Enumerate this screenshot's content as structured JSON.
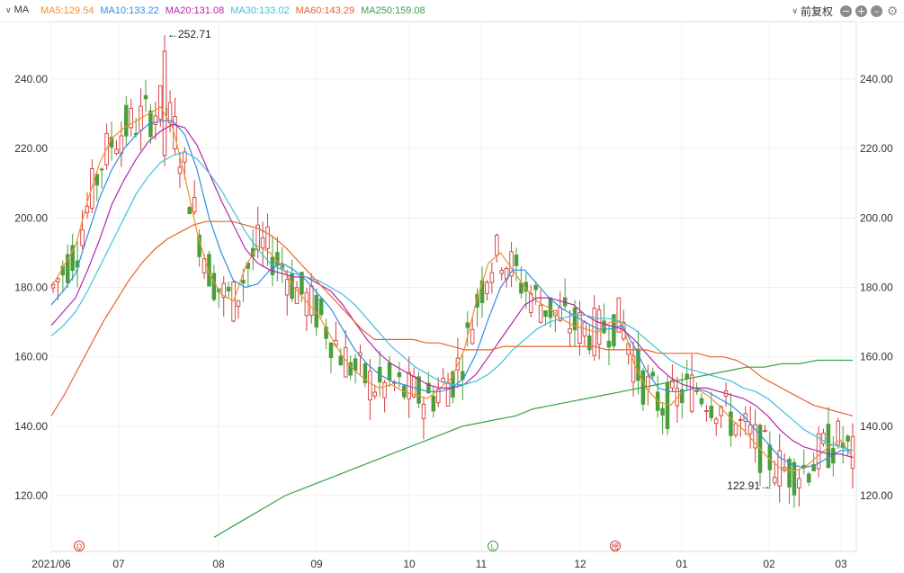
{
  "toolbar": {
    "ma_label": "MA",
    "legend": [
      {
        "text": "MA5:129.54",
        "color": "#f0932b"
      },
      {
        "text": "MA10:133.22",
        "color": "#2f8fe0"
      },
      {
        "text": "MA20:131.08",
        "color": "#b326ad"
      },
      {
        "text": "MA30:133.02",
        "color": "#3cc2dd"
      },
      {
        "text": "MA60:143.29",
        "color": "#e8622c"
      },
      {
        "text": "MA250:159.08",
        "color": "#35a243"
      }
    ],
    "adjust_label": "前复权"
  },
  "chart_data": {
    "type": "candlestick",
    "y_ticks": [
      "240.00",
      "220.00",
      "200.00",
      "180.00",
      "160.00",
      "140.00",
      "120.00"
    ],
    "ylim": [
      105,
      252.71
    ],
    "x_ticks": [
      "2021/06",
      "07",
      "08",
      "09",
      "10",
      "11",
      "12",
      "01",
      "02",
      "03"
    ],
    "annotations": {
      "max": {
        "value": 252.71,
        "label": "←252.71"
      },
      "min": {
        "value": 122.91,
        "label": "122.91→"
      }
    },
    "event_markers": [
      "Q",
      "L",
      "榜"
    ],
    "colors": {
      "up": "#d63b3b",
      "down": "#4a9e3b"
    },
    "ma_lines": [
      {
        "name": "MA5",
        "color": "#f0932b",
        "values": [
          180,
          186,
          192,
          205,
          216,
          223,
          226,
          228,
          230,
          232,
          226,
          212,
          196,
          184,
          178,
          176,
          186,
          192,
          190,
          186,
          180,
          176,
          172,
          166,
          160,
          156,
          153,
          151,
          152,
          150,
          149,
          148,
          151,
          154,
          162,
          176,
          187,
          190,
          185,
          180,
          176,
          174,
          171,
          169,
          168,
          167,
          170,
          170,
          158,
          151,
          147,
          146,
          150,
          151,
          149,
          146,
          142,
          139,
          135,
          131,
          128,
          127,
          128,
          131,
          134,
          136,
          131
        ]
      },
      {
        "name": "MA10",
        "color": "#2f8fe0",
        "values": [
          175,
          179,
          184,
          195,
          206,
          214,
          220,
          224,
          227,
          228,
          228,
          224,
          214,
          200,
          190,
          182,
          180,
          181,
          185,
          187,
          185,
          182,
          178,
          174,
          168,
          162,
          158,
          155,
          153,
          152,
          151,
          150,
          150,
          151,
          154,
          161,
          171,
          180,
          185,
          185,
          181,
          177,
          174,
          172,
          170,
          168,
          168,
          169,
          163,
          156,
          151,
          150,
          150,
          151,
          150,
          148,
          146,
          143,
          139,
          135,
          131,
          129,
          128,
          129,
          131,
          133,
          133
        ]
      },
      {
        "name": "MA20",
        "color": "#b326ad",
        "values": [
          169,
          173,
          177,
          185,
          194,
          204,
          211,
          217,
          222,
          225,
          227,
          226,
          221,
          213,
          205,
          198,
          191,
          187,
          185,
          184,
          183,
          183,
          181,
          179,
          175,
          170,
          165,
          161,
          158,
          156,
          154,
          152,
          151,
          151,
          152,
          155,
          160,
          165,
          170,
          175,
          177,
          177,
          176,
          175,
          172,
          170,
          169,
          168,
          165,
          161,
          157,
          154,
          152,
          151,
          151,
          150,
          149,
          148,
          146,
          143,
          139,
          136,
          134,
          133,
          132,
          132,
          131
        ]
      },
      {
        "name": "MA30",
        "color": "#3cc2dd",
        "values": [
          166,
          169,
          173,
          179,
          186,
          193,
          200,
          207,
          212,
          216,
          218,
          219,
          217,
          213,
          208,
          202,
          196,
          191,
          187,
          185,
          184,
          183,
          182,
          180,
          178,
          175,
          171,
          167,
          163,
          160,
          157,
          155,
          153,
          152,
          152,
          153,
          155,
          158,
          162,
          165,
          168,
          170,
          171,
          172,
          172,
          171,
          171,
          170,
          168,
          165,
          162,
          159,
          157,
          156,
          155,
          154,
          153,
          151,
          150,
          148,
          145,
          142,
          139,
          137,
          135,
          134,
          133
        ]
      },
      {
        "name": "MA60",
        "color": "#e8622c",
        "values": [
          143,
          149,
          156,
          163,
          170,
          176,
          182,
          187,
          191,
          194,
          196,
          198,
          199,
          199,
          199,
          198,
          197,
          195,
          192,
          188,
          184,
          180,
          176,
          172,
          168,
          165,
          165,
          165,
          165,
          164,
          164,
          163,
          162,
          162,
          162,
          163,
          163,
          163,
          163,
          163,
          163,
          163,
          163,
          162,
          162,
          162,
          162,
          161,
          161,
          161,
          161,
          160,
          160,
          159,
          157,
          154,
          152,
          150,
          148,
          146,
          145,
          144,
          143
        ]
      },
      {
        "name": "MA250",
        "color": "#35a243",
        "values": [
          108,
          111,
          114,
          117,
          120,
          122,
          124,
          126,
          128,
          130,
          132,
          134,
          136,
          138,
          140,
          141,
          142,
          143,
          145,
          146,
          147,
          148,
          149,
          150,
          151,
          152,
          153,
          154,
          155,
          156,
          157,
          157,
          158,
          158,
          159,
          159,
          159
        ]
      }
    ]
  }
}
